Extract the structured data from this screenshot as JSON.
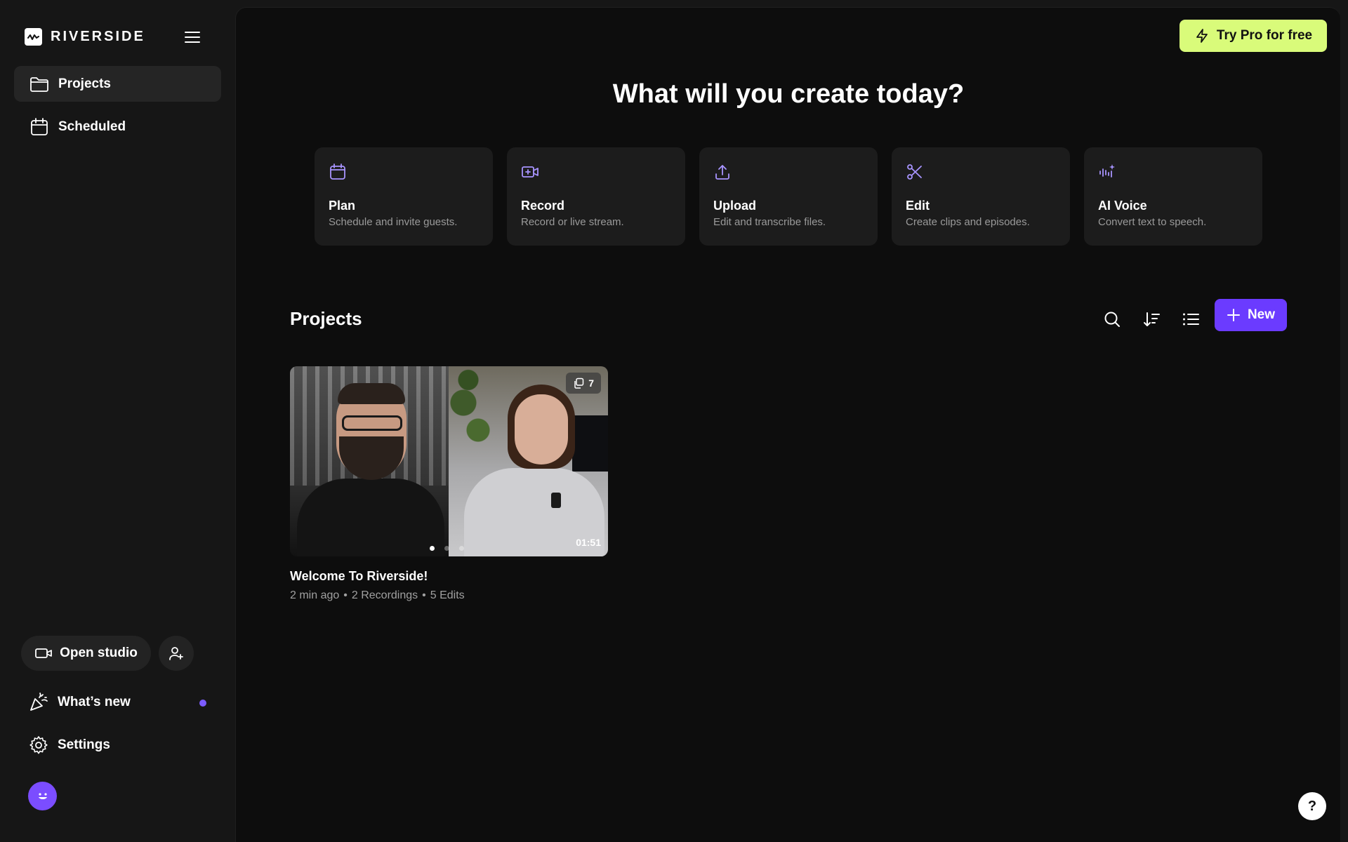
{
  "brand": {
    "name": "RIVERSIDE"
  },
  "sidebar": {
    "nav": [
      {
        "label": "Projects",
        "icon": "folder-icon",
        "active": true
      },
      {
        "label": "Scheduled",
        "icon": "calendar-icon",
        "active": false
      }
    ],
    "open_studio_label": "Open studio",
    "whats_new_label": "What’s new",
    "settings_label": "Settings"
  },
  "header": {
    "try_pro_label": "Try Pro for free"
  },
  "hero": {
    "headline": "What will you create today?"
  },
  "create_cards": [
    {
      "title": "Plan",
      "desc": "Schedule and invite guests.",
      "icon": "calendar-icon"
    },
    {
      "title": "Record",
      "desc": "Record or live stream.",
      "icon": "video-plus-icon"
    },
    {
      "title": "Upload",
      "desc": "Edit and transcribe files.",
      "icon": "upload-icon"
    },
    {
      "title": "Edit",
      "desc": "Create clips and episodes.",
      "icon": "scissors-icon"
    },
    {
      "title": "AI Voice",
      "desc": "Convert text to speech.",
      "icon": "ai-voice-icon"
    }
  ],
  "projects": {
    "title": "Projects",
    "new_label": "New",
    "items": [
      {
        "title": "Welcome To Riverside!",
        "time": "2 min ago",
        "recordings": "2 Recordings",
        "edits": "5 Edits",
        "clip_count": "7",
        "duration": "01:51",
        "separator": "•"
      }
    ]
  },
  "help_label": "?",
  "colors": {
    "accent_purple": "#6b3bff",
    "pro_lime": "#d9fb7a",
    "icon_purple": "#a894ff"
  }
}
